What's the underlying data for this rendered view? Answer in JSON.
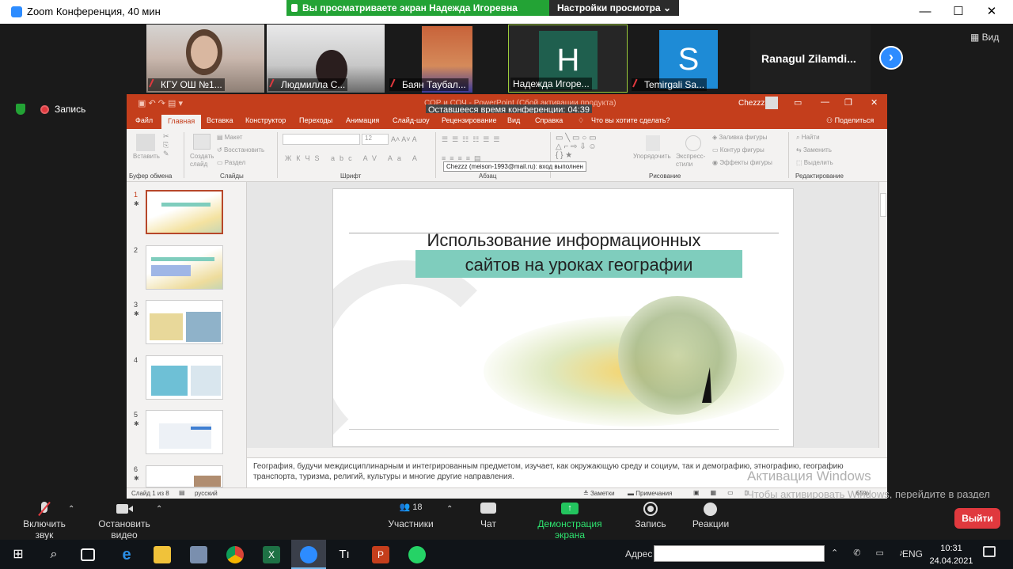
{
  "window": {
    "title": "Zoom Конференция, 40 мин"
  },
  "banner": {
    "sharing_text": "Вы просматриваете экран Надежда Игоревна Ушакова",
    "view_options": "Настройки просмотра ⌄"
  },
  "gallery": {
    "participants": [
      {
        "name": "КГУ ОШ №1...",
        "muted": true
      },
      {
        "name": "Людмилла С...",
        "muted": true
      },
      {
        "name": "Баян Таубал...",
        "muted": true
      },
      {
        "name": "Надежда Игоре...",
        "muted": false,
        "letter": "H",
        "color": "#1f5f4e"
      },
      {
        "name": "Temirgali Sa...",
        "muted": true,
        "letter": "S",
        "color": "#1e8bd6"
      },
      {
        "name": "Ranagul  Zilamdi..."
      }
    ],
    "view_label": "Вид"
  },
  "status": {
    "record_label": "Запись"
  },
  "ppt": {
    "title_text": "СОР и СОЧ - PowerPoint (Сбой активации продукта)",
    "user": "Chezzz",
    "meeting_timer": "Оставшееся время конференции: 04:39",
    "tabs": [
      "Файл",
      "Главная",
      "Вставка",
      "Конструктор",
      "Переходы",
      "Анимация",
      "Слайд-шоу",
      "Рецензирование",
      "Вид",
      "Справка"
    ],
    "tell_me": "Что вы хотите сделать?",
    "share": "Поделиться",
    "ribbon": {
      "paste": "Вставить",
      "create_slide": "Создать слайд",
      "layout": "Макет",
      "reset": "Восстановить",
      "section": "Раздел",
      "shape_fill": "Заливка фигуры",
      "shape_outline": "Контур фигуры",
      "shape_effects": "Эффекты фигуры",
      "arrange": "Упорядочить",
      "quick_styles": "Экспресс-стили",
      "find": "Найти",
      "replace": "Заменить",
      "select": "Выделить",
      "font_size": "12"
    },
    "groups": [
      "Буфер обмена",
      "Слайды",
      "Шрифт",
      "Абзац",
      "Рисование",
      "Редактирование"
    ],
    "tooltip": "Chezzz (meison-1993@mail.ru): вход выполнен",
    "slide_numbers": [
      "1",
      "2",
      "3",
      "4",
      "5",
      "6"
    ],
    "slide": {
      "title_line1": "Использование информационных",
      "title_line2": "сайтов на уроках географии"
    },
    "notes": "География, будучи междисциплинарным и интегрированным предметом, изучает, как окружающую среду и социум, так и демографию, этнографию, географию транспорта, туризма, религий, культуры и многие другие направления.",
    "statusbar": {
      "slide_of": "Слайд 1 из 8",
      "language": "русский",
      "notes_btn": "Заметки",
      "comments_btn": "Примечания",
      "zoom": "65%"
    }
  },
  "activation": {
    "line1": "Активация Windows",
    "line2": "Чтобы активировать Windows, перейдите в раздел \"Параметры\"."
  },
  "toolbar": {
    "unmute": "Включить звук",
    "start_video": "Остановить видео",
    "participants": "Участники",
    "participants_count": "18",
    "chat": "Чат",
    "share": "Демонстрация экрана",
    "record": "Запись",
    "reactions": "Реакции",
    "leave": "Выйти"
  },
  "taskbar": {
    "address_label": "Адрес",
    "lang": "ENG",
    "time": "10:31",
    "date": "24.04.2021"
  },
  "colors": {
    "zoom_blue": "#2d8cff",
    "share_green": "#23a335",
    "ppt_red": "#c43e1c",
    "leave_red": "#e0393e"
  }
}
